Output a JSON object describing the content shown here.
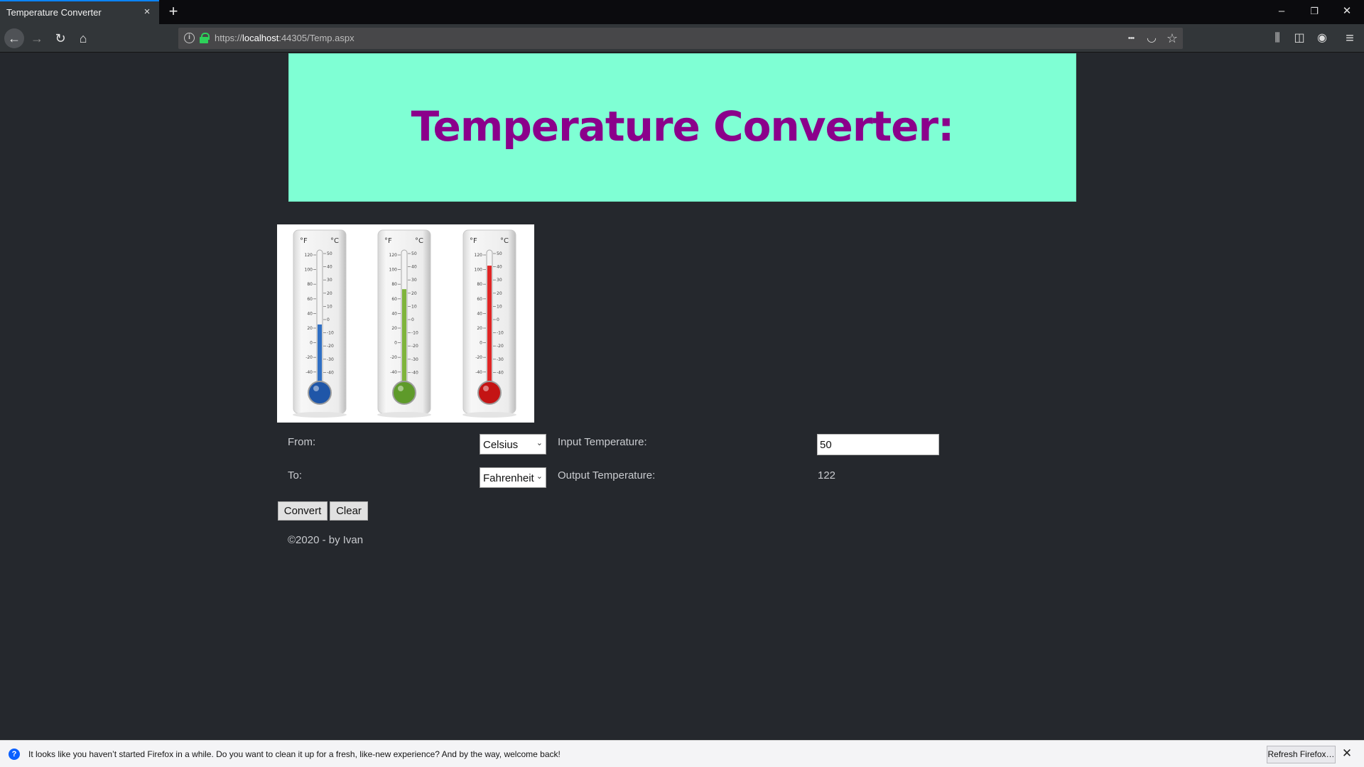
{
  "browser": {
    "tab_title": "Temperature Converter",
    "tab_close_icon": "×",
    "new_tab_icon": "+",
    "url_scheme": "https://",
    "url_host": "localhost",
    "url_rest": ":44305/Temp.aspx",
    "window_controls": {
      "minimize": "–",
      "restore": "❐",
      "close": "✕"
    },
    "nav": {
      "back": "←",
      "forward": "→",
      "reload": "↻",
      "home": "⌂"
    },
    "url_actions": {
      "more": "•••",
      "pocket": "◡",
      "bookmark": "☆"
    },
    "toolbar": {
      "library": "⫼",
      "sidebar": "◫",
      "account": "◉",
      "menu": "≡"
    }
  },
  "page": {
    "title": "Temperature Converter:",
    "from_label": "From:",
    "from_value": "Celsius",
    "to_label": "To:",
    "to_value": "Fahrenheit",
    "input_label": "Input Temperature:",
    "input_value": "50",
    "output_label": "Output Temperature:",
    "output_value": "122",
    "convert_button": "Convert",
    "clear_button": "Clear",
    "footer": "©2020 - by Ivan"
  },
  "thermometers": {
    "f_unit": "°F",
    "c_unit": "°C",
    "f_ticks": [
      "120",
      "100",
      "80",
      "60",
      "40",
      "20",
      "0",
      "-20",
      "-40"
    ],
    "c_ticks": [
      "50",
      "40",
      "30",
      "20",
      "10",
      "0",
      "-10",
      "-20",
      "-30",
      "-40"
    ],
    "items": [
      {
        "color": "#2f6fc4",
        "bulb": "#1f56a8",
        "level": 0.43
      },
      {
        "color": "#7fb43c",
        "bulb": "#5e9a2a",
        "level": 0.7
      },
      {
        "color": "#e02525",
        "bulb": "#c41414",
        "level": 0.88
      }
    ]
  },
  "notification": {
    "text": "It looks like you haven’t started Firefox in a while. Do you want to clean it up for a fresh, like-new experience? And by the way, welcome back!",
    "button": "Refresh Firefox…",
    "close": "✕"
  },
  "colors": {
    "banner": "#7fffd4",
    "title": "#8b008b",
    "background": "#25282d"
  }
}
